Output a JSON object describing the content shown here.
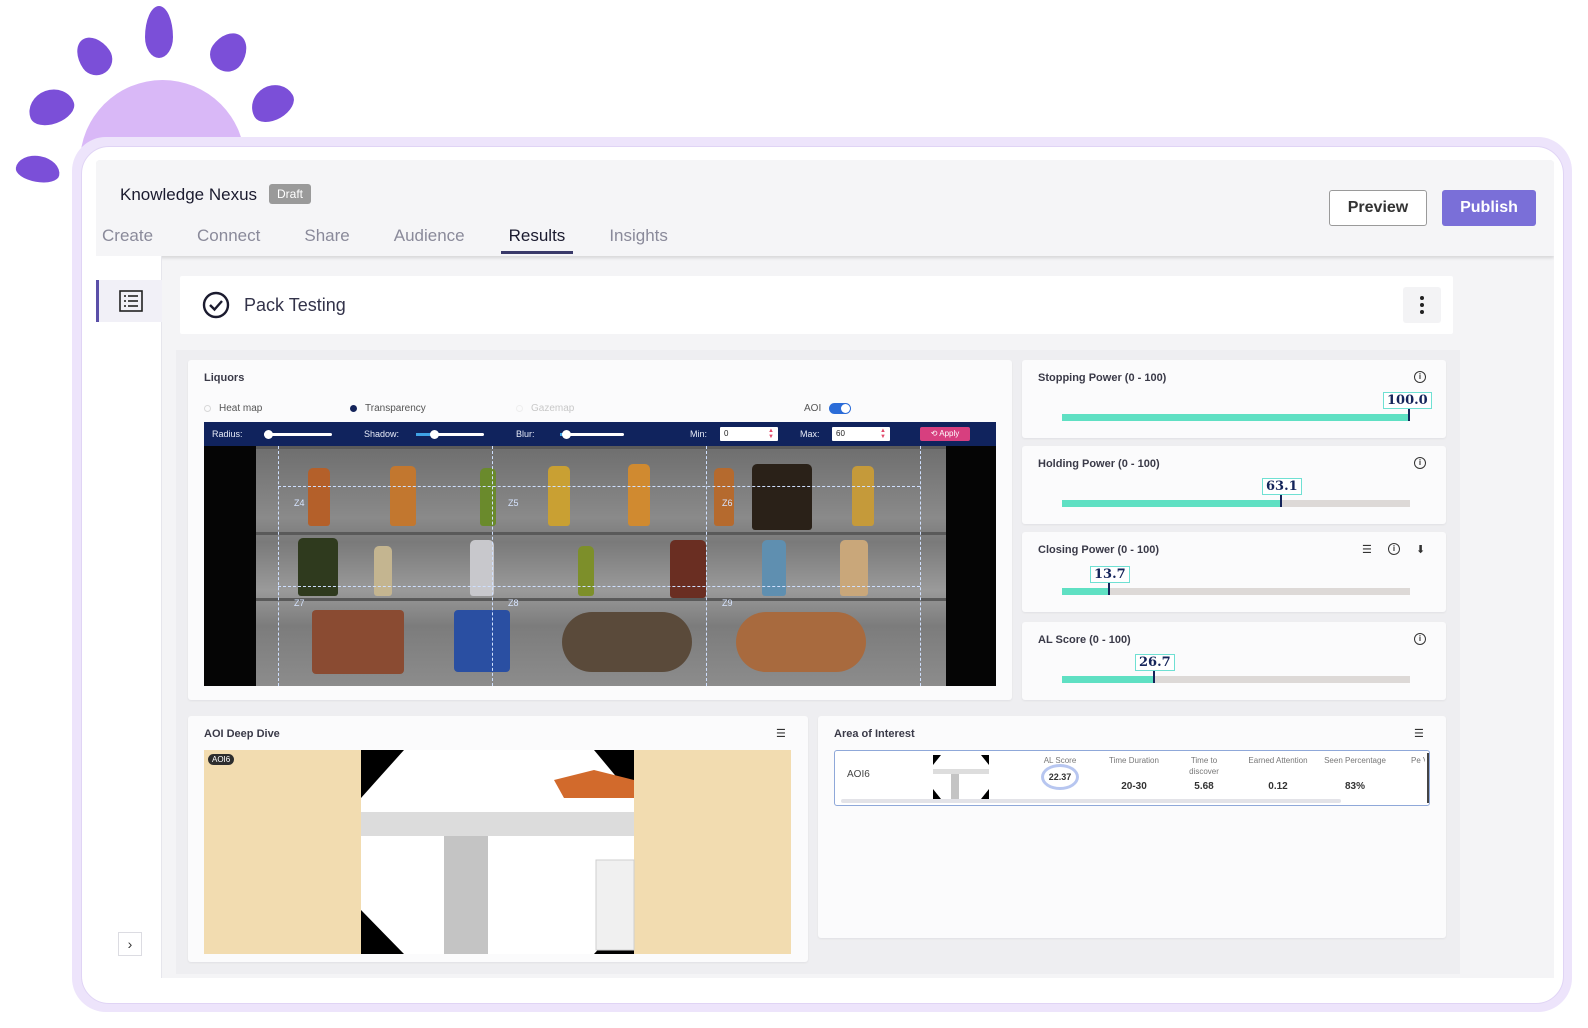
{
  "app": {
    "title": "Knowledge Nexus",
    "status_badge": "Draft",
    "tabs": [
      "Create",
      "Connect",
      "Share",
      "Audience",
      "Results",
      "Insights"
    ],
    "active_tab": "Results",
    "preview_label": "Preview",
    "publish_label": "Publish"
  },
  "page": {
    "title": "Pack Testing"
  },
  "liquors": {
    "title": "Liquors",
    "options": [
      "Heat map",
      "Transparency",
      "Gazemap"
    ],
    "selected_option": "Transparency",
    "aoi_label": "AOI",
    "aoi_enabled": true,
    "controls": {
      "radius_label": "Radius:",
      "shadow_label": "Shadow:",
      "blur_label": "Blur:",
      "min_label": "Min:",
      "min_value": "0",
      "max_label": "Max:",
      "max_value": "60",
      "apply_label": "Apply"
    },
    "zones": [
      "Z4",
      "Z5",
      "Z6",
      "Z7",
      "Z8",
      "Z9"
    ]
  },
  "metrics": [
    {
      "title": "Stopping Power (0 - 100)",
      "value": "100.0",
      "fraction": 1.0
    },
    {
      "title": "Holding Power (0 - 100)",
      "value": "63.1",
      "fraction": 0.631
    },
    {
      "title": "Closing Power (0 - 100)",
      "value": "13.7",
      "fraction": 0.137
    },
    {
      "title": "AL Score (0 - 100)",
      "value": "26.7",
      "fraction": 0.267
    }
  ],
  "aoi_deep_dive": {
    "title": "AOI Deep Dive",
    "tag": "AOI6"
  },
  "area_of_interest": {
    "title": "Area of Interest",
    "row_label": "AOI6",
    "columns": [
      {
        "label": "AL Score",
        "value": "22.37"
      },
      {
        "label": "Time Duration",
        "value": "20-30"
      },
      {
        "label": "Time to discover",
        "value": "5.68"
      },
      {
        "label": "Earned Attention",
        "value": "0.12"
      },
      {
        "label": "Seen Percentage",
        "value": "83%"
      },
      {
        "label": "Pe V",
        "value": ""
      }
    ]
  },
  "colors": {
    "accent": "#7a6fd8",
    "bar_fill": "#5fe0c3",
    "nav_dark": "#10235d",
    "apply": "#d73f7f"
  }
}
